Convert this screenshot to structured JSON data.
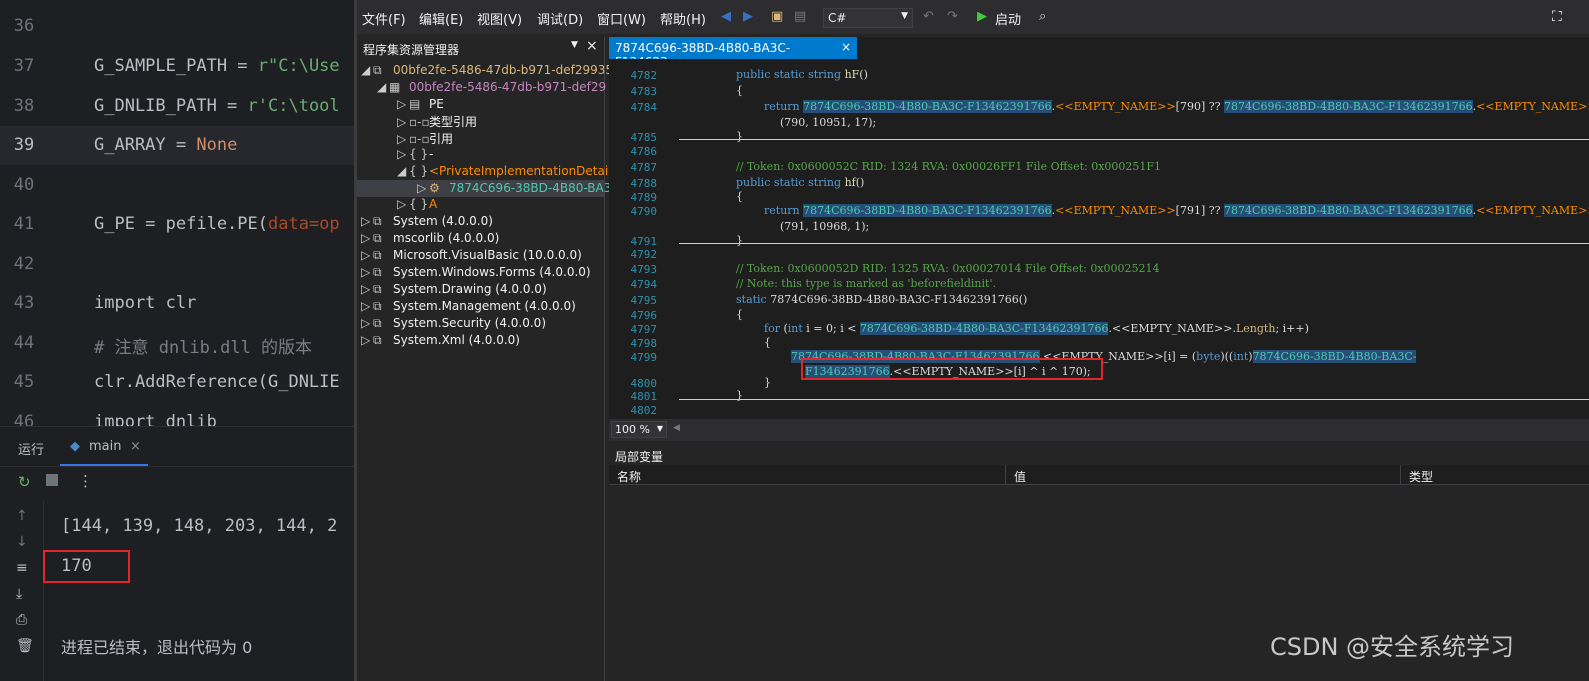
{
  "pycharm": {
    "line_numbers": [
      "36",
      "37",
      "38",
      "39",
      "40",
      "41",
      "42",
      "43",
      "44",
      "45",
      "46"
    ],
    "lines": [
      {
        "n": "37",
        "t": "G_SAMPLE_PATH = ",
        "s": "r\"C:\\Use"
      },
      {
        "n": "38",
        "t": "G_DNLIB_PATH = ",
        "s": "r'C:\\tool"
      },
      {
        "n": "39",
        "t": "G_ARRAY = ",
        "s": "None"
      },
      {
        "n": "41",
        "t": "G_PE = pefile.PE(",
        "s": "data=op"
      },
      {
        "n": "43",
        "t": "import clr"
      },
      {
        "n": "44",
        "t": "# 注意 dnlib.dll 的版本"
      },
      {
        "n": "45",
        "t": "clr.AddReference(G_DNLIE"
      },
      {
        "n": "46",
        "t": "import dnlib"
      }
    ],
    "run_tab": "运行",
    "run_config": "main",
    "output_line1": "[144, 139, 148, 203, 144, 2",
    "output_line2": "170",
    "output_end": "进程已结束，退出代码为 0"
  },
  "dnspy": {
    "menu": [
      "文件(F)",
      "编辑(E)",
      "视图(V)",
      "调试(D)",
      "窗口(W)",
      "帮助(H)"
    ],
    "language": "C#",
    "start_label": "启动",
    "assembly_panel_title": "程序集资源管理器",
    "tree": [
      "00bfe2fe-5486-47db-b971-def29935",
      "00bfe2fe-5486-47db-b971-def29",
      "PE",
      "类型引用",
      "引用",
      "-",
      "<PrivateImplementationDetail",
      "7874C696-38BD-4B80-BA3",
      "A",
      "System (4.0.0.0)",
      "mscorlib (4.0.0.0)",
      "Microsoft.VisualBasic (10.0.0.0)",
      "System.Windows.Forms (4.0.0.0)",
      "System.Drawing (4.0.0.0)",
      "System.Management (4.0.0.0)",
      "System.Security (4.0.0.0)",
      "System.Xml (4.0.0.0)"
    ],
    "doc_tab": "7874C696-38BD-4B80-BA3C-F134623...",
    "class_name": "7874C696-38BD-4B80-BA3C-F13462391766",
    "zoom": "100 %",
    "locals_title": "局部变量",
    "locals_cols": [
      "名称",
      "值",
      "类型"
    ],
    "code": {
      "l4782": "public static string hF()",
      "l4784_idx": "[790] ??",
      "l4785": "(790, 10951, 17);",
      "l4787": "// Token: 0x0600052C RID: 1324 RVA: 0x00026FF1 File Offset: 0x000251F1",
      "l4788": "public static string hf()",
      "l4790_idx": "[791] ??",
      "l4791": "(791, 10968, 1);",
      "l4793": "// Token: 0x0600052D RID: 1325 RVA: 0x00027014 File Offset: 0x00025214",
      "l4794": "// Note: this type is marked as 'beforefieldinit'.",
      "l4795": "static 7874C696-38BD-4B80-BA3C-F13462391766()",
      "empty": "<<EMPTY_NAME>>"
    }
  },
  "watermark": "CSDN @安全系统学习"
}
